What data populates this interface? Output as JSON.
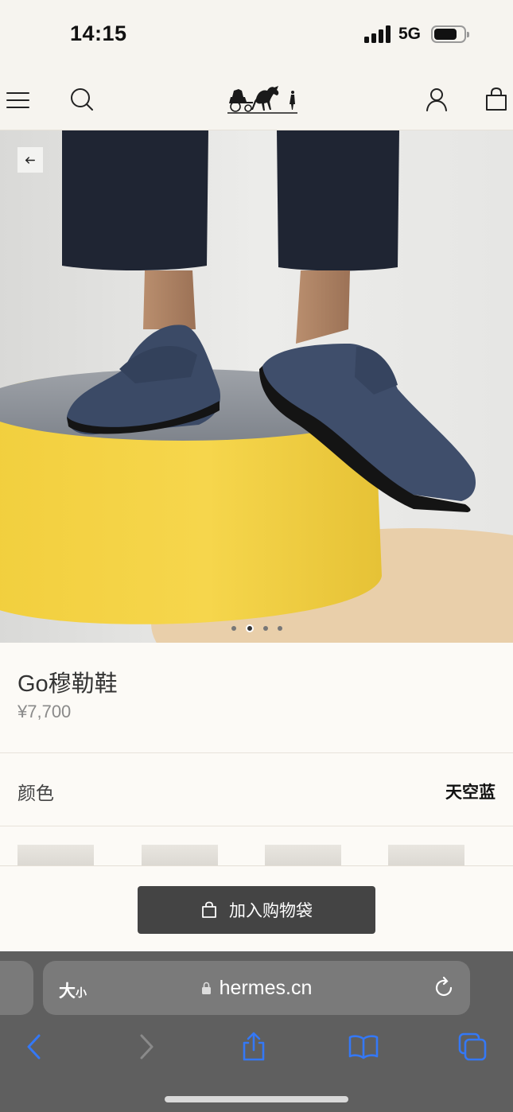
{
  "status_bar": {
    "time": "14:15",
    "network": "5G"
  },
  "header": {
    "logo_alt": "Hermès carriage logo"
  },
  "hero": {
    "slide_count": 4,
    "active_slide": 2
  },
  "product": {
    "name": "Go穆勒鞋",
    "price": "¥7,700"
  },
  "color": {
    "label": "颜色",
    "value": "天空蓝"
  },
  "cta": {
    "add_to_bag": "加入购物袋"
  },
  "browser": {
    "text_size_big": "大",
    "text_size_small": "小",
    "url": "hermes.cn"
  },
  "colors": {
    "accent": "#3478f6",
    "button": "#444444",
    "background": "#f6f4ef"
  }
}
